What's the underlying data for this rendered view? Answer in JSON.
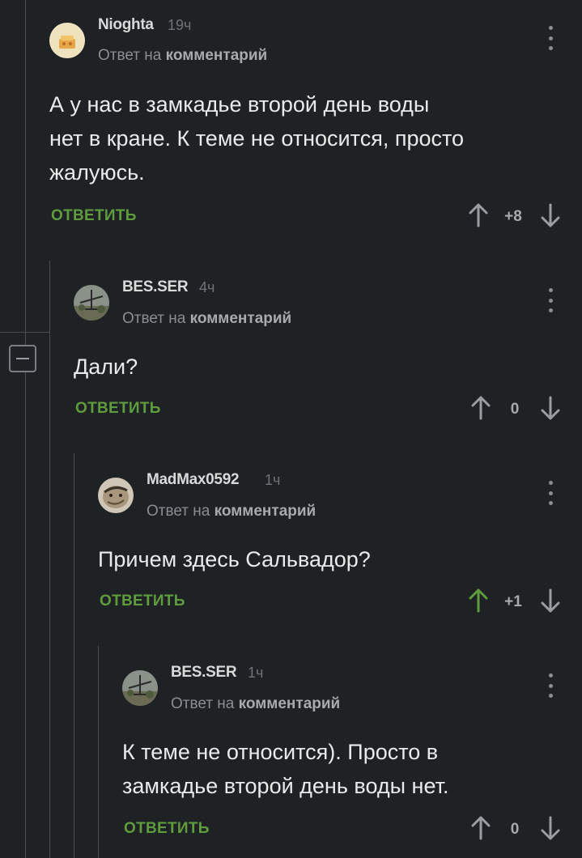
{
  "comments": [
    {
      "username": "Nioghta",
      "time": "19ч",
      "reply_prefix": "Ответ на",
      "reply_target": "комментарий",
      "lines": [
        "А у нас в замкадье второй день воды",
        "нет в кране. К теме не относится, просто",
        "жалуюсь."
      ],
      "reply_label": "ОТВЕТИТЬ",
      "score": "+8",
      "upvoted": false
    },
    {
      "username": "BES.SER",
      "time": "4ч",
      "reply_prefix": "Ответ на",
      "reply_target": "комментарий",
      "lines": [
        "Дали?"
      ],
      "reply_label": "ОТВЕТИТЬ",
      "score": "0",
      "upvoted": false
    },
    {
      "username": "MadMax0592",
      "time": "1ч",
      "reply_prefix": "Ответ на",
      "reply_target": "комментарий",
      "lines": [
        "Причем здесь Сальвадор?"
      ],
      "reply_label": "ОТВЕТИТЬ",
      "score": "+1",
      "upvoted": true
    },
    {
      "username": "BES.SER",
      "time": "1ч",
      "reply_prefix": "Ответ на",
      "reply_target": "комментарий",
      "lines": [
        "К теме не относится). Просто в",
        "замкадье второй день воды нет."
      ],
      "reply_label": "ОТВЕТИТЬ",
      "score": "0",
      "upvoted": false
    }
  ],
  "colors": {
    "background": "#1f2224",
    "accent_green": "#5f9c3d",
    "upvote_active": "#5f9c3d",
    "text": "#eaeaea",
    "muted": "#8a8e92"
  },
  "icons": {
    "menu": "more-vertical-icon",
    "upvote": "arrow-up-icon",
    "downvote": "arrow-down-icon",
    "collapse": "minus-square-icon"
  }
}
